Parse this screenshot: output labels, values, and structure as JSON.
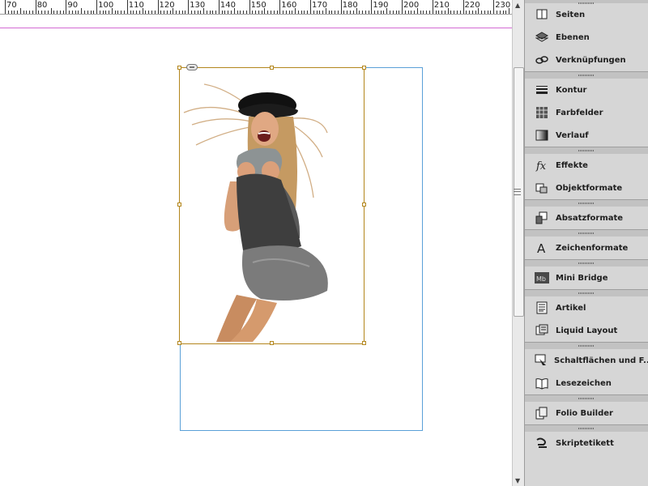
{
  "ruler": {
    "labels": [
      "70",
      "80",
      "90",
      "100",
      "110",
      "120",
      "130",
      "140",
      "150",
      "160",
      "170",
      "180",
      "190",
      "200",
      "210",
      "220",
      "230"
    ]
  },
  "document": {
    "image_description_icon": "linked-image-icon"
  },
  "panels": [
    [
      {
        "label": "Seiten",
        "icon": "pages-icon"
      },
      {
        "label": "Ebenen",
        "icon": "layers-icon"
      },
      {
        "label": "Verknüpfungen",
        "icon": "links-icon"
      }
    ],
    [
      {
        "label": "Kontur",
        "icon": "stroke-icon"
      },
      {
        "label": "Farbfelder",
        "icon": "swatches-icon"
      },
      {
        "label": "Verlauf",
        "icon": "gradient-icon"
      }
    ],
    [
      {
        "label": "Effekte",
        "icon": "fx-icon"
      },
      {
        "label": "Objektformate",
        "icon": "object-styles-icon"
      }
    ],
    [
      {
        "label": "Absatzformate",
        "icon": "paragraph-styles-icon"
      }
    ],
    [
      {
        "label": "Zeichenformate",
        "icon": "character-styles-icon"
      }
    ],
    [
      {
        "label": "Mini Bridge",
        "icon": "mini-bridge-icon"
      }
    ],
    [
      {
        "label": "Artikel",
        "icon": "articles-icon"
      },
      {
        "label": "Liquid Layout",
        "icon": "liquid-layout-icon"
      }
    ],
    [
      {
        "label": "Schaltflächen und F...",
        "icon": "buttons-forms-icon"
      },
      {
        "label": "Lesezeichen",
        "icon": "bookmarks-icon"
      }
    ],
    [
      {
        "label": "Folio Builder",
        "icon": "folio-builder-icon"
      }
    ],
    [
      {
        "label": "Skriptetikett",
        "icon": "script-label-icon"
      }
    ]
  ],
  "colors": {
    "frame": "#b3861c",
    "bleed": "#5aa0d8",
    "margin": "#d36bd3"
  }
}
